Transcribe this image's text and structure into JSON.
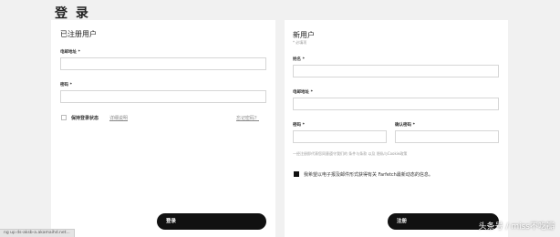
{
  "page": {
    "title": "登 录"
  },
  "login": {
    "heading": "已注册用户",
    "email_label": "电邮地址 *",
    "email_value": "",
    "password_label": "密码 *",
    "password_value": "",
    "remember_label": "保持登录状态",
    "remember_details": "详细说明",
    "forgot_link": "忘记密码？",
    "submit_label": "登录"
  },
  "register": {
    "heading": "新用户",
    "required_note": "* 必填项",
    "name_label": "姓名 *",
    "email_label": "电邮地址 *",
    "password_label": "密码 *",
    "confirm_label": "确认密码 *",
    "terms_text": "一经注册即代表您同意遵守我们的 条件与条款 以及 隐私与Cookie政策",
    "newsletter_label": "我希望以电子报及邮件形式获得有关 Farfetch最新动态的信息。",
    "submit_label": "注册"
  },
  "status_bar": {
    "text": "ng up ds-aksb-a.akamaihd.net..."
  },
  "watermark": {
    "text": "头条号 / miss不吃瓣"
  }
}
